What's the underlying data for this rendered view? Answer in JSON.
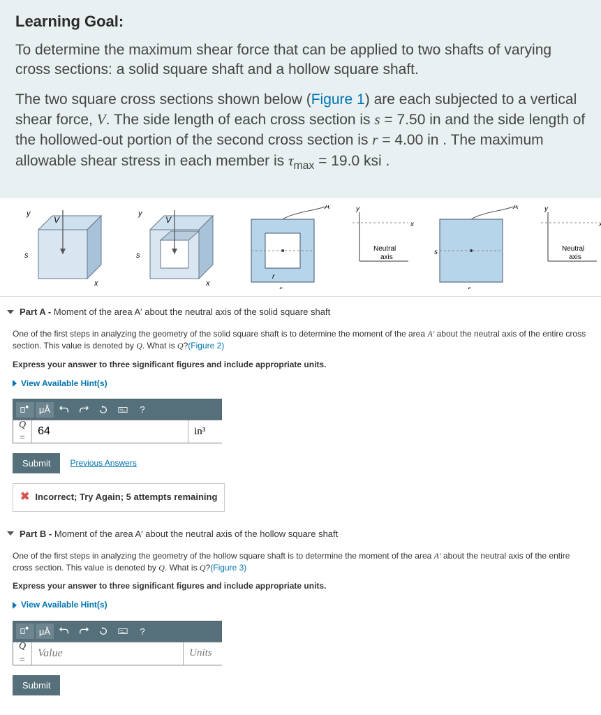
{
  "intro": {
    "title": "Learning Goal:",
    "para1_pre": "To determine the maximum shear force that can be applied to two shafts of varying cross sections: a solid square shaft and a hollow square shaft.",
    "para2_pre": "The two square cross sections shown below (",
    "para2_fig": "Figure 1",
    "para2_mid1": ") are each subjected to a vertical shear force, ",
    "para2_V": "V",
    "para2_mid2": ". The side length of each cross section is ",
    "para2_s": "s",
    "para2_eq1": " = 7.50 in",
    "para2_mid3": " and the side length of the hollowed-out portion of the second cross section is ",
    "para2_r": "r",
    "para2_eq2": " = 4.00 in",
    "para2_mid4": " . The maximum allowable shear stress in each member is ",
    "para2_tau": "τ",
    "para2_max": "max",
    "para2_eq3": " = 19.0 ksi ."
  },
  "fig_labels": {
    "y": "y",
    "x": "x",
    "s": "s",
    "r": "r",
    "V": "V",
    "Aprime": "A′",
    "neutral": "Neutral",
    "axis": "axis"
  },
  "partA": {
    "title_bold": "Part A - ",
    "title_rest": "Moment of the area A′ about the neutral axis of the solid square shaft",
    "body_pre": "One of the first steps in analyzing the geometry of the solid square shaft is to determine the moment of the area ",
    "body_A": "A′",
    "body_mid": " about the neutral axis of the entire cross section. This value is denoted by ",
    "body_Q": "Q",
    "body_post": ". What is ",
    "body_Q2": "Q",
    "body_q": "?",
    "fig_link": "(Figure 2)",
    "instruction": "Express your answer to three significant figures and include appropriate units.",
    "hints": "View Available Hint(s)",
    "input_label": "Q",
    "value": "64",
    "units": "in³",
    "submit": "Submit",
    "prev": "Previous Answers",
    "feedback": "Incorrect; Try Again; 5 attempts remaining"
  },
  "partB": {
    "title_bold": "Part B - ",
    "title_rest": "Moment of the area A′ about the neutral axis of the hollow square shaft",
    "body_pre": "One of the first steps in analyzing the geometry of the hollow square shaft is to determine the moment of the area ",
    "body_A": "A′",
    "body_mid": " about the neutral axis of the entire cross section. This value is denoted by ",
    "body_Q": "Q",
    "body_post": ". What is ",
    "body_Q2": "Q",
    "body_q": "?",
    "fig_link": "(Figure 3)",
    "instruction": "Express your answer to three significant figures and include appropriate units.",
    "hints": "View Available Hint(s)",
    "input_label": "Q",
    "value_ph": "Value",
    "units_ph": "Units",
    "submit": "Submit"
  },
  "toolbar": {
    "mu_a": "μÅ",
    "help": "?"
  }
}
